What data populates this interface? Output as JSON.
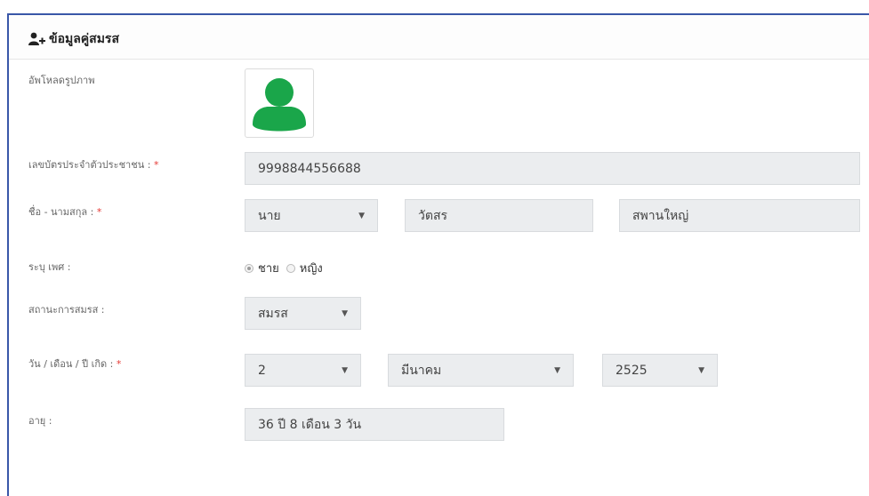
{
  "header": {
    "title": "ข้อมูลคู่สมรส"
  },
  "photo": {
    "label": "อัพโหลดรูปภาพ"
  },
  "citizen_id": {
    "label": "เลขบัตรประจำตัวประชาชน :",
    "required": "*",
    "value": "9998844556688"
  },
  "name": {
    "label": "ชื่อ - นามสกุล :",
    "required": "*",
    "prefix": "นาย",
    "first_name": "วัตสร",
    "last_name": "สพานใหญ่"
  },
  "gender": {
    "label": "ระบุ เพศ :",
    "options": [
      "ชาย",
      "หญิง"
    ],
    "selected": "ชาย"
  },
  "marital_status": {
    "label": "สถานะการสมรส :",
    "value": "สมรส"
  },
  "birth_date": {
    "label": "วัน / เดือน / ปี เกิด :",
    "required": "*",
    "day": "2",
    "month": "มีนาคม",
    "year": "2525"
  },
  "age": {
    "label": "อายุ :",
    "value": "36 ปี 8 เดือน 3 วัน"
  },
  "colors": {
    "accent_border": "#3a57a8",
    "avatar_green": "#1aa64a",
    "field_bg": "#ebedef",
    "required": "#e53935"
  },
  "icons": {
    "title": "user-plus-icon",
    "select": "caret-down-icon"
  }
}
